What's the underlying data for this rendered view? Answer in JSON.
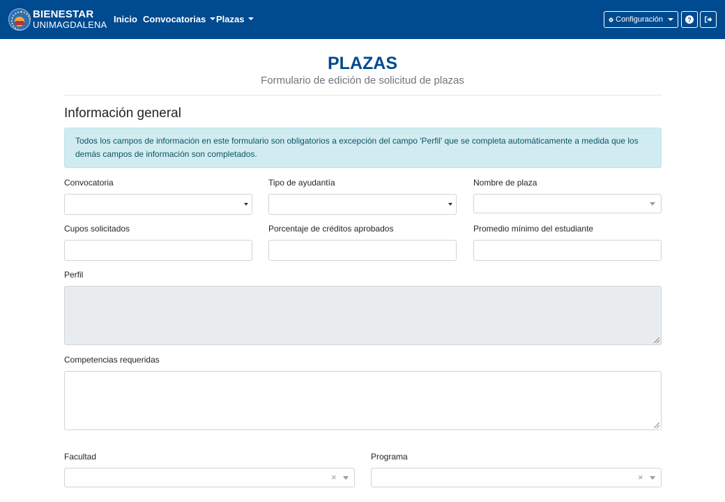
{
  "navbar": {
    "brand_top": "BIENESTAR",
    "brand_bottom": "UNIMAGDALENA",
    "links": [
      {
        "label": "Inicio",
        "dropdown": false
      },
      {
        "label": "Convocatorias",
        "dropdown": true
      },
      {
        "label": "Plazas",
        "dropdown": true
      }
    ],
    "config_label": "Configuración",
    "config_icon": "gear-icon",
    "help_icon": "question-circle-icon",
    "logout_icon": "sign-out-icon",
    "bg_color": "#004a8f"
  },
  "header": {
    "title": "PLAZAS",
    "subtitle": "Formulario de edición de solicitud de plazas"
  },
  "section": {
    "title": "Información general"
  },
  "alert": {
    "text": "Todos los campos de información en este formulario son obligatorios a excepción del campo 'Perfil' que se completa automáticamente a medida que los demás campos de información son completados."
  },
  "form": {
    "convocatoria": {
      "label": "Convocatoria",
      "value": ""
    },
    "tipo_ayudantia": {
      "label": "Tipo de ayudantía",
      "value": ""
    },
    "nombre_plaza": {
      "label": "Nombre de plaza",
      "value": ""
    },
    "cupos": {
      "label": "Cupos solicitados",
      "value": ""
    },
    "porcentaje": {
      "label": "Porcentaje de créditos aprobados",
      "value": ""
    },
    "promedio": {
      "label": "Promedio mínimo del estudiante",
      "value": ""
    },
    "perfil": {
      "label": "Perfil",
      "value": ""
    },
    "competencias": {
      "label": "Competencias requeridas",
      "value": ""
    },
    "facultad": {
      "label": "Facultad",
      "value": "",
      "clear": "×"
    },
    "programa": {
      "label": "Programa",
      "value": "",
      "clear": "×"
    }
  }
}
